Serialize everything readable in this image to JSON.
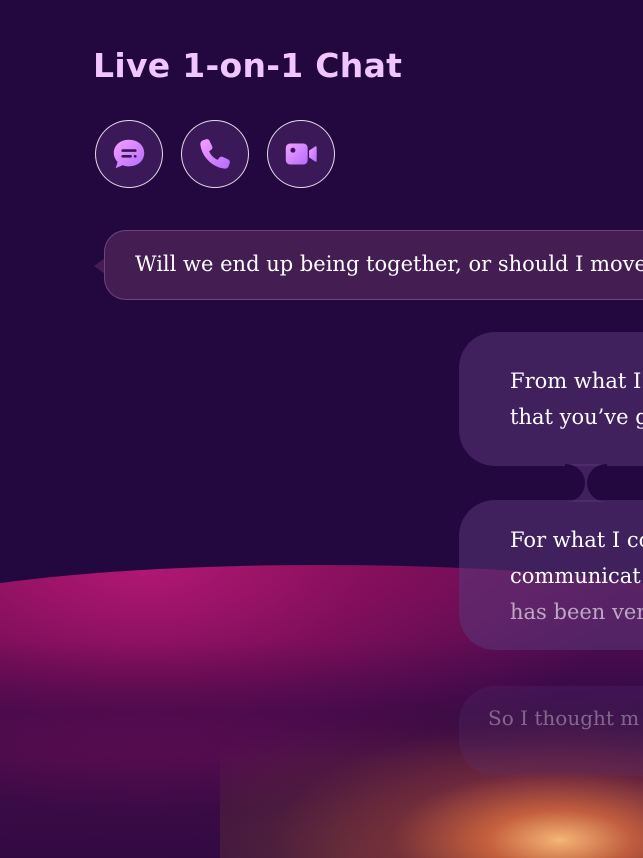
{
  "header": {
    "title": "Live 1-on-1 Chat"
  },
  "actions": [
    {
      "name": "chat",
      "icon": "chat-bubble-icon"
    },
    {
      "name": "call",
      "icon": "phone-icon"
    },
    {
      "name": "video",
      "icon": "video-camera-icon"
    }
  ],
  "messages": {
    "user": {
      "text": "Will we end up being together, or should I move"
    },
    "replies": [
      {
        "lines": [
          "From what I’",
          "that you’ve g"
        ]
      },
      {
        "lines": [
          "For what I co",
          "communicat",
          "has been ver"
        ]
      },
      {
        "lines": [
          "So I thought m"
        ]
      }
    ]
  },
  "colors": {
    "background": "#23073f",
    "title": "#f1c6ff",
    "icon_gradient_start": "#f3a0ff",
    "icon_gradient_end": "#b36bff",
    "user_bubble": "#482055",
    "reply_bubble": "#5a3778"
  }
}
